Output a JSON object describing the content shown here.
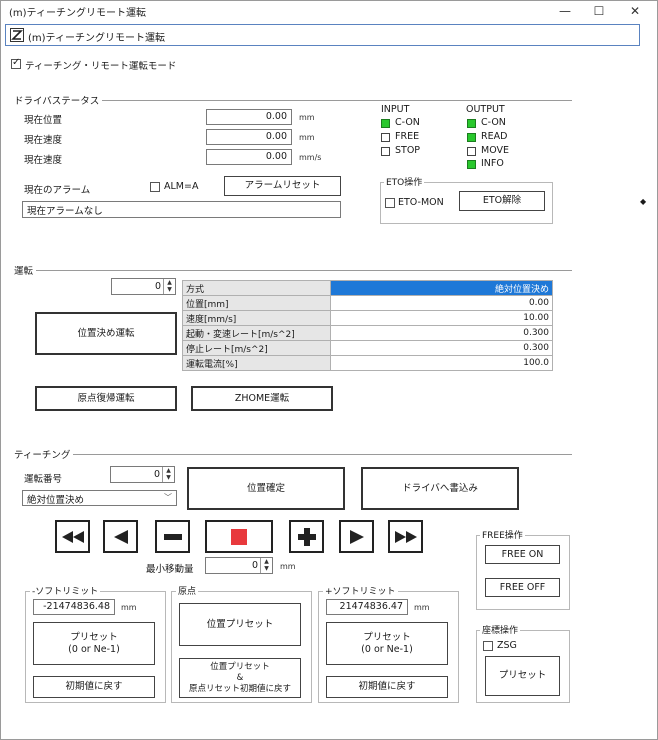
{
  "window": {
    "title": "(m)ティーチングリモート運転"
  },
  "header": {
    "title": "(m)ティーチングリモート運転"
  },
  "remote_mode": {
    "label": "ティーチング・リモート運転モード",
    "checked": true
  },
  "driver_status": {
    "section_title": "ドライバステータス",
    "rows": [
      {
        "label": "現在位置",
        "value": "0.00",
        "unit": "mm"
      },
      {
        "label": "現在速度",
        "value": "0.00",
        "unit": "mm"
      },
      {
        "label": "現在速度",
        "value": "0.00",
        "unit": "mm/s"
      }
    ],
    "alarm_label": "現在のアラーム",
    "alarm_check_label": "ALM=A",
    "alarm_reset_button": "アラームリセット",
    "alarm_text": "現在アラームなし",
    "input": {
      "title": "INPUT",
      "items": [
        {
          "label": "C-ON",
          "on": true
        },
        {
          "label": "FREE",
          "on": false
        },
        {
          "label": "STOP",
          "on": false
        }
      ]
    },
    "output": {
      "title": "OUTPUT",
      "items": [
        {
          "label": "C-ON",
          "on": true
        },
        {
          "label": "READ",
          "on": true
        },
        {
          "label": "MOVE",
          "on": false
        },
        {
          "label": "INFO",
          "on": true
        }
      ]
    },
    "eto": {
      "title": "ETO操作",
      "check_label": "ETO-MON",
      "button": "ETO解除"
    }
  },
  "operation": {
    "section_title": "運転",
    "number": "0",
    "position_button": "位置決め運転",
    "return_home_button": "原点復帰運転",
    "zhome_button": "ZHOME運転",
    "table": [
      {
        "key": "方式",
        "value": "絶対位置決め",
        "selected": true
      },
      {
        "key": "位置[mm]",
        "value": "0.00",
        "selected": false
      },
      {
        "key": "速度[mm/s]",
        "value": "10.00",
        "selected": false
      },
      {
        "key": "起動・変速レート[m/s^2]",
        "value": "0.300",
        "selected": false
      },
      {
        "key": "停止レート[m/s^2]",
        "value": "0.300",
        "selected": false
      },
      {
        "key": "運転電流[%]",
        "value": "100.0",
        "selected": false
      }
    ]
  },
  "teaching": {
    "section_title": "ティーチング",
    "number_label": "運転番号",
    "number": "0",
    "mode_select": "絶対位置決め",
    "position_fix_button": "位置確定",
    "driver_write_button": "ドライバへ書込み",
    "jog_label": "最小移動量",
    "jog_value": "0",
    "jog_unit": "mm",
    "jog_icons": [
      "fast-backward-icon",
      "backward-icon",
      "minus-icon",
      "stop-icon",
      "plus-icon",
      "forward-icon",
      "fast-forward-icon"
    ],
    "stop_color": "#e8393d",
    "free": {
      "title": "FREE操作",
      "on_button": "FREE ON",
      "off_button": "FREE OFF"
    },
    "soft_limit_minus": {
      "title": "-ソフトリミット",
      "value": "-21474836.48",
      "unit": "mm",
      "preset_button": "プリセット\n(0 or Ne-1)",
      "restore_button": "初期値に戻す"
    },
    "home": {
      "title": "原点",
      "preset_button": "位置プリセット",
      "restore_button": "位置プリセット\n&\n原点リセット初期値に戻す"
    },
    "soft_limit_plus": {
      "title": "+ソフトリミット",
      "value": "21474836.47",
      "unit": "mm",
      "preset_button": "プリセット\n(0 or Ne-1)",
      "restore_button": "初期値に戻す"
    },
    "coord": {
      "title": "座標操作",
      "check_label": "ZSG",
      "preset_button": "プリセット"
    }
  }
}
